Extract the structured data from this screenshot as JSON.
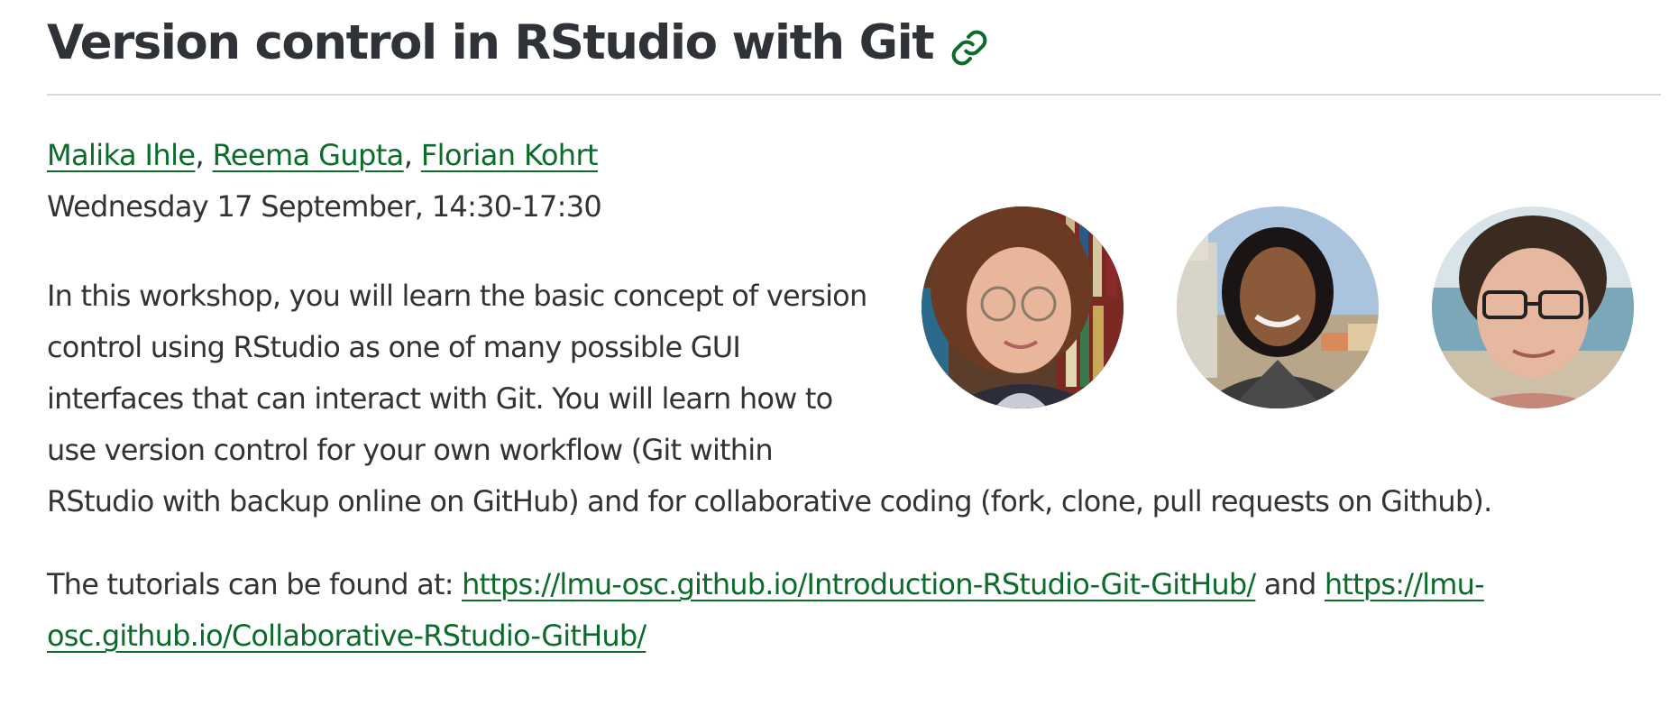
{
  "page": {
    "title": "Version control in RStudio with Git",
    "anchor_icon": "link-icon"
  },
  "authors": [
    {
      "name": "Malika Ihle"
    },
    {
      "name": "Reema Gupta"
    },
    {
      "name": "Florian Kohrt"
    }
  ],
  "author_separator": ", ",
  "datetime": "Wednesday 17 September, 14:30-17:30",
  "description_lines": [
    "In this workshop, you will learn the basic concept of version",
    "control using RStudio as one of many possible GUI",
    "interfaces that can interact with Git. You will learn how to",
    "use version control for your own workflow (Git within",
    "RStudio with backup online on GitHub) and for collaborative coding (fork, clone, pull requests on Github)."
  ],
  "tutorials": {
    "prefix": "The tutorials can be found at: ",
    "link1": "https://lmu-osc.github.io/Introduction-RStudio-Git-GitHub/",
    "conjunction": " and ",
    "link2_part1": "https://lmu-",
    "link2_part2": "osc.github.io/Collaborative-RStudio-GitHub/"
  },
  "colors": {
    "link": "#0b6b2a",
    "text": "#333333",
    "title": "#2f3237",
    "divider": "#d9d9d9"
  }
}
